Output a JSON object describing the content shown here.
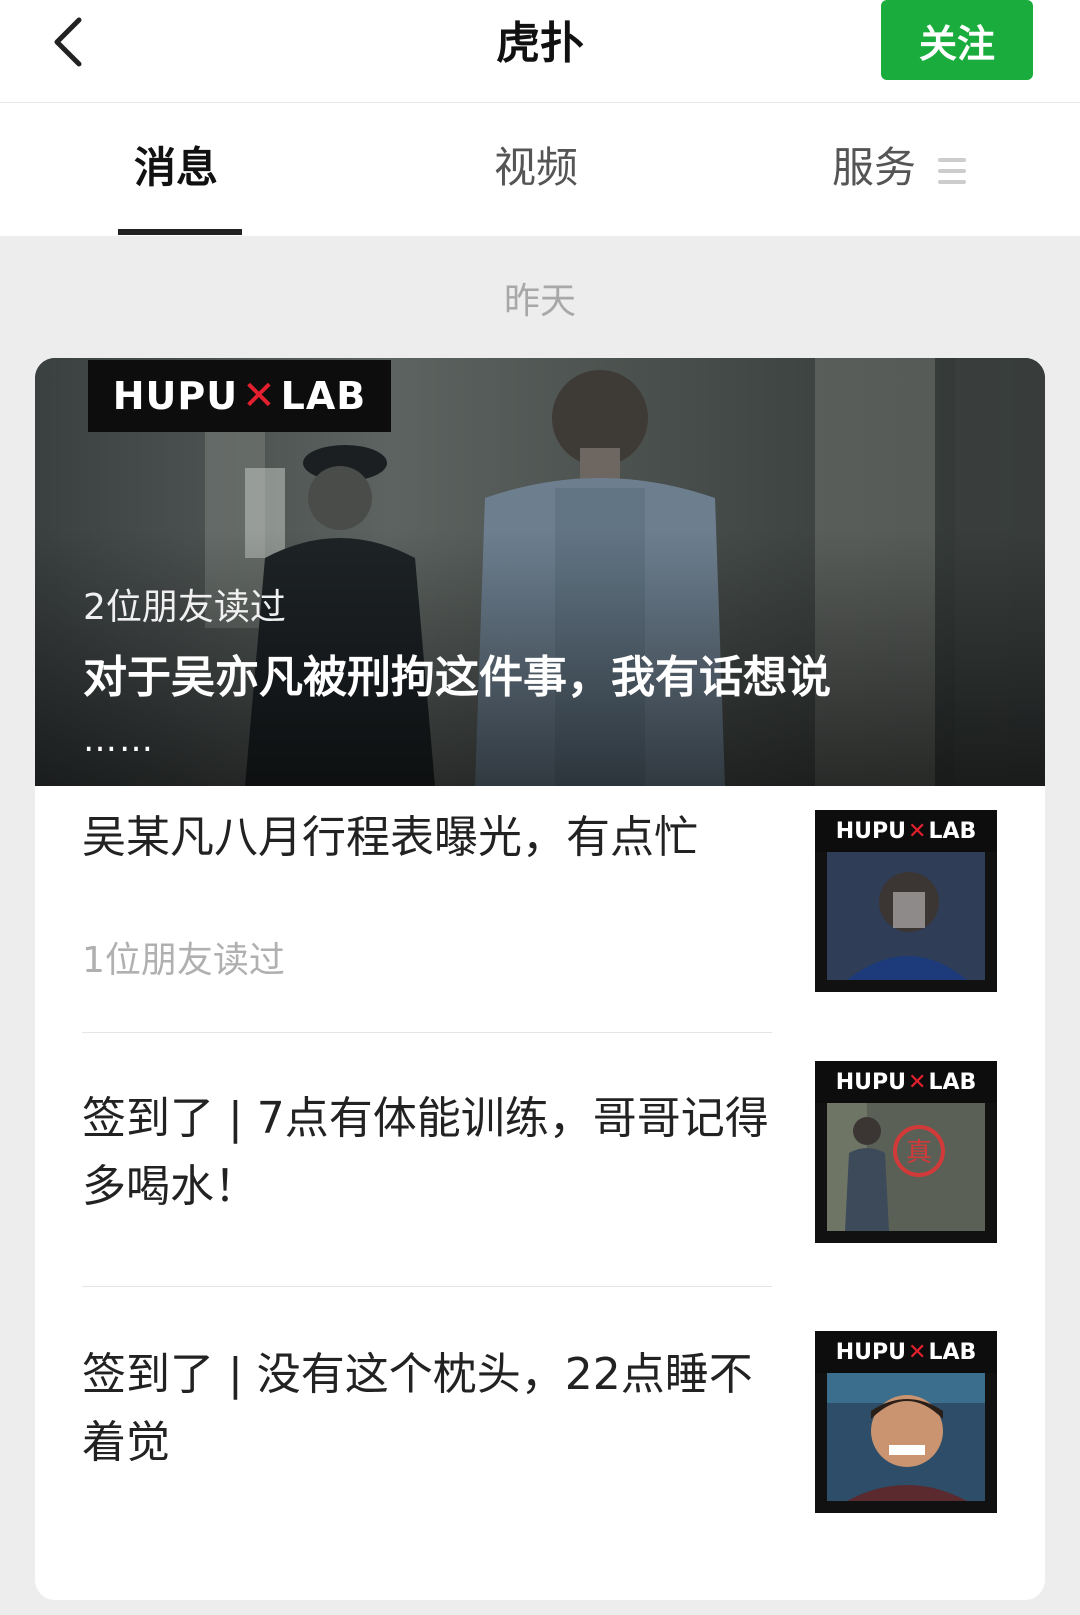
{
  "header": {
    "title": "虎扑",
    "follow_label": "关注"
  },
  "tabs": [
    {
      "label": "消息",
      "active": true
    },
    {
      "label": "视频",
      "active": false
    },
    {
      "label": "服务",
      "active": false
    }
  ],
  "date_label": "昨天",
  "hero": {
    "logo_left": "HUPU",
    "logo_x": "✕",
    "logo_right": "LAB",
    "readers": "2位朋友读过",
    "title": "对于吴亦凡被刑拘这件事，我有话想说",
    "ellipsis": "……"
  },
  "articles": [
    {
      "title": "吴某凡八月行程表曝光，有点忙",
      "readers": "1位朋友读过"
    },
    {
      "title": "签到了 | 7点有体能训练，哥哥记得多喝水！",
      "readers": ""
    },
    {
      "title": "签到了 | 没有这个枕头，22点睡不着觉",
      "readers": ""
    }
  ],
  "thumb_logo": {
    "left": "HUPU",
    "x": "✕",
    "right": "LAB"
  },
  "colors": {
    "accent": "#1aad3d",
    "logo_x": "#e5202e"
  }
}
